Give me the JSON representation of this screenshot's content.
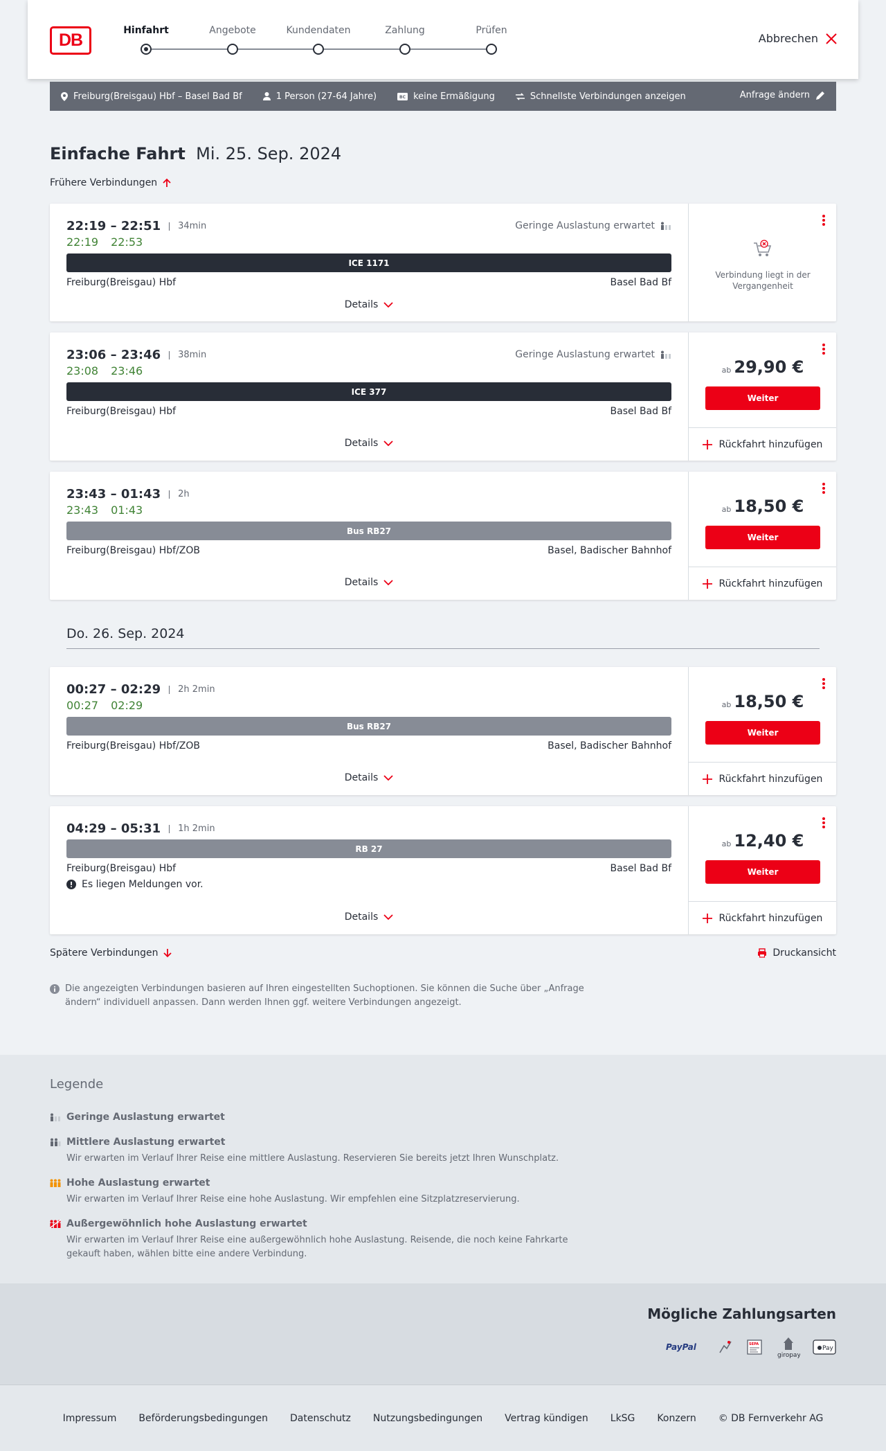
{
  "header": {
    "logo": "DB",
    "steps": [
      "Hinfahrt",
      "Angebote",
      "Kundendaten",
      "Zahlung",
      "Prüfen"
    ],
    "cancel": "Abbrechen"
  },
  "summary": {
    "route": "Freiburg(Breisgau) Hbf – Basel Bad Bf",
    "persons": "1 Person (27-64 Jahre)",
    "discount": "keine Ermäßigung",
    "fastest": "Schnellste Verbindungen anzeigen",
    "edit": "Anfrage ändern"
  },
  "page": {
    "title_bold": "Einfache Fahrt",
    "title_date": "Mi. 25. Sep. 2024",
    "earlier": "Frühere Verbindungen",
    "later": "Spätere Verbindungen",
    "print": "Druckansicht",
    "day2": "Do. 26. Sep. 2024",
    "info": "Die angezeigten Verbindungen basieren auf Ihren eingestellten Suchoptionen. Sie können die Suche über „Anfrage ändern“ individuell anpassen. Dann werden Ihnen ggf. weitere Verbindungen angezeigt."
  },
  "labels": {
    "details": "Details",
    "weiter": "Weiter",
    "ab": "ab",
    "return": "Rückfahrt hinzufügen",
    "past": "Verbindung liegt in der Vergangenheit",
    "occ_low": "Geringe Auslastung erwartet"
  },
  "connections": [
    {
      "times": "22:19 – 22:51",
      "dur": "34min",
      "rt_dep": "22:19",
      "rt_arr": "22:53",
      "train": "ICE 1171",
      "from": "Freiburg(Breisgau) Hbf",
      "to": "Basel Bad Bf",
      "occupancy": "Geringe Auslastung erwartet",
      "past": true
    },
    {
      "times": "23:06 – 23:46",
      "dur": "38min",
      "rt_dep": "23:08",
      "rt_arr": "23:46",
      "train": "ICE 377",
      "from": "Freiburg(Breisgau) Hbf",
      "to": "Basel Bad Bf",
      "occupancy": "Geringe Auslastung erwartet",
      "price": "29,90 €"
    },
    {
      "times": "23:43 – 01:43",
      "dur": "2h",
      "rt_dep": "23:43",
      "rt_arr": "01:43",
      "train": "Bus RB27",
      "from": "Freiburg(Breisgau) Hbf/ZOB",
      "to": "Basel, Badischer Bahnhof",
      "price": "18,50 €"
    },
    {
      "times": "00:27 – 02:29",
      "dur": "2h 2min",
      "rt_dep": "00:27",
      "rt_arr": "02:29",
      "train": "Bus RB27",
      "from": "Freiburg(Breisgau) Hbf/ZOB",
      "to": "Basel, Badischer Bahnhof",
      "price": "18,50 €"
    },
    {
      "times": "04:29 – 05:31",
      "dur": "1h 2min",
      "train": "RB 27",
      "from": "Freiburg(Breisgau) Hbf",
      "to": "Basel Bad Bf",
      "message": "Es liegen Meldungen vor.",
      "price": "12,40 €"
    }
  ],
  "legend": {
    "title": "Legende",
    "items": [
      {
        "title": "Geringe Auslastung erwartet",
        "desc": ""
      },
      {
        "title": "Mittlere Auslastung erwartet",
        "desc": "Wir erwarten im Verlauf Ihrer Reise eine mittlere Auslastung. Reservieren Sie bereits jetzt Ihren Wunschplatz."
      },
      {
        "title": "Hohe Auslastung erwartet",
        "desc": "Wir erwarten im Verlauf Ihrer Reise eine hohe Auslastung. Wir empfehlen eine Sitzplatzreservierung."
      },
      {
        "title": "Außergewöhnlich hohe Auslastung erwartet",
        "desc": "Wir erwarten im Verlauf Ihrer Reise eine außergewöhnlich hohe Auslastung. Reisende, die noch keine Fahrkarte gekauft haben, wählen bitte eine andere Verbindung."
      }
    ]
  },
  "payment": {
    "title": "Mögliche Zahlungsarten",
    "paypal": "PayPal",
    "sepa": "SEPA",
    "giropay": "giropay",
    "applepay": "Pay"
  },
  "footer": [
    "Impressum",
    "Beförderungsbedingungen",
    "Datenschutz",
    "Nutzungsbedingungen",
    "Vertrag kündigen",
    "LkSG",
    "Konzern",
    "© DB Fernverkehr AG"
  ],
  "colors": {
    "accent": "#ec0016",
    "realtime": "#408335",
    "dark": "#282d37"
  }
}
